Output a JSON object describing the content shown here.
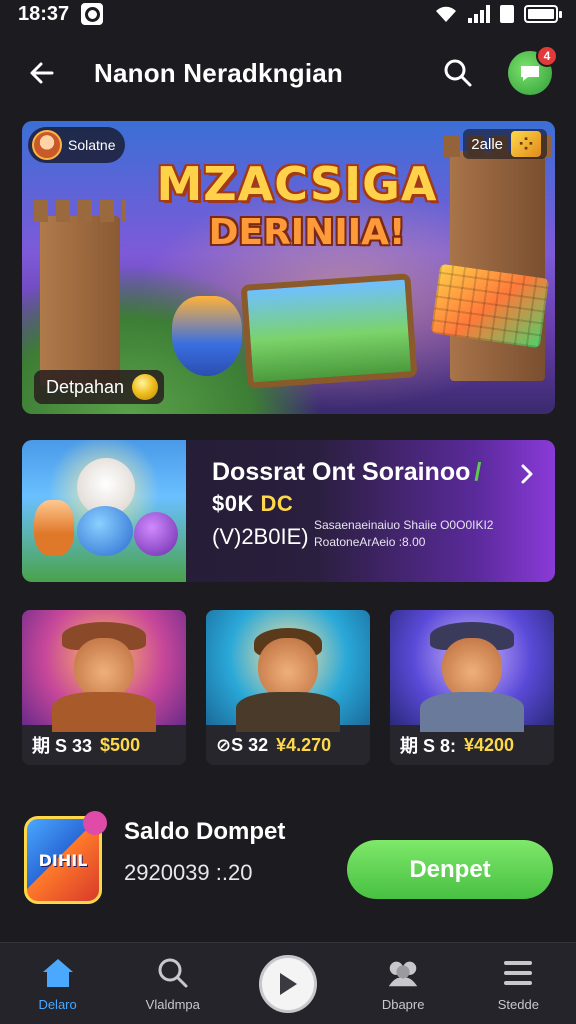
{
  "status_bar": {
    "time": "18:37"
  },
  "header": {
    "title": "Nanon Neradkngian"
  },
  "hero": {
    "chip_left": "Solatne",
    "chip_right": "2alle",
    "title": "MZACSIGA",
    "subtitle": "DERINIIA!",
    "cta": "Detpahan"
  },
  "promo": {
    "title": "Dossrat Ont Sorainoo",
    "amount_prefix": "$0K",
    "amount_accent": "DC",
    "code": "(V)2B0IE)",
    "detail_line_1": "Sasaenaeinaiuo Shaiie O0O0IKI2",
    "detail_line_2": "RoatoneArAeio :8.00"
  },
  "cards": [
    {
      "code": "期 S 33",
      "price": "$500"
    },
    {
      "code": "⊘S 32",
      "price": "¥4.270"
    },
    {
      "code": "期 S 8:",
      "price": "¥4200"
    }
  ],
  "wallet": {
    "icon_text": "DIHIL",
    "label": "Saldo Dompet",
    "balance": "2920039 :.20",
    "button": "Denpet"
  },
  "nav": [
    {
      "label": "Delaro"
    },
    {
      "label": "Vlaldmpa"
    },
    {
      "label": "Dbapre"
    },
    {
      "label": "Stedde"
    }
  ],
  "notification_count": "4",
  "colors": {
    "accent": "#48c042",
    "nav_active": "#4aa8ff",
    "price": "#ffd84a"
  }
}
